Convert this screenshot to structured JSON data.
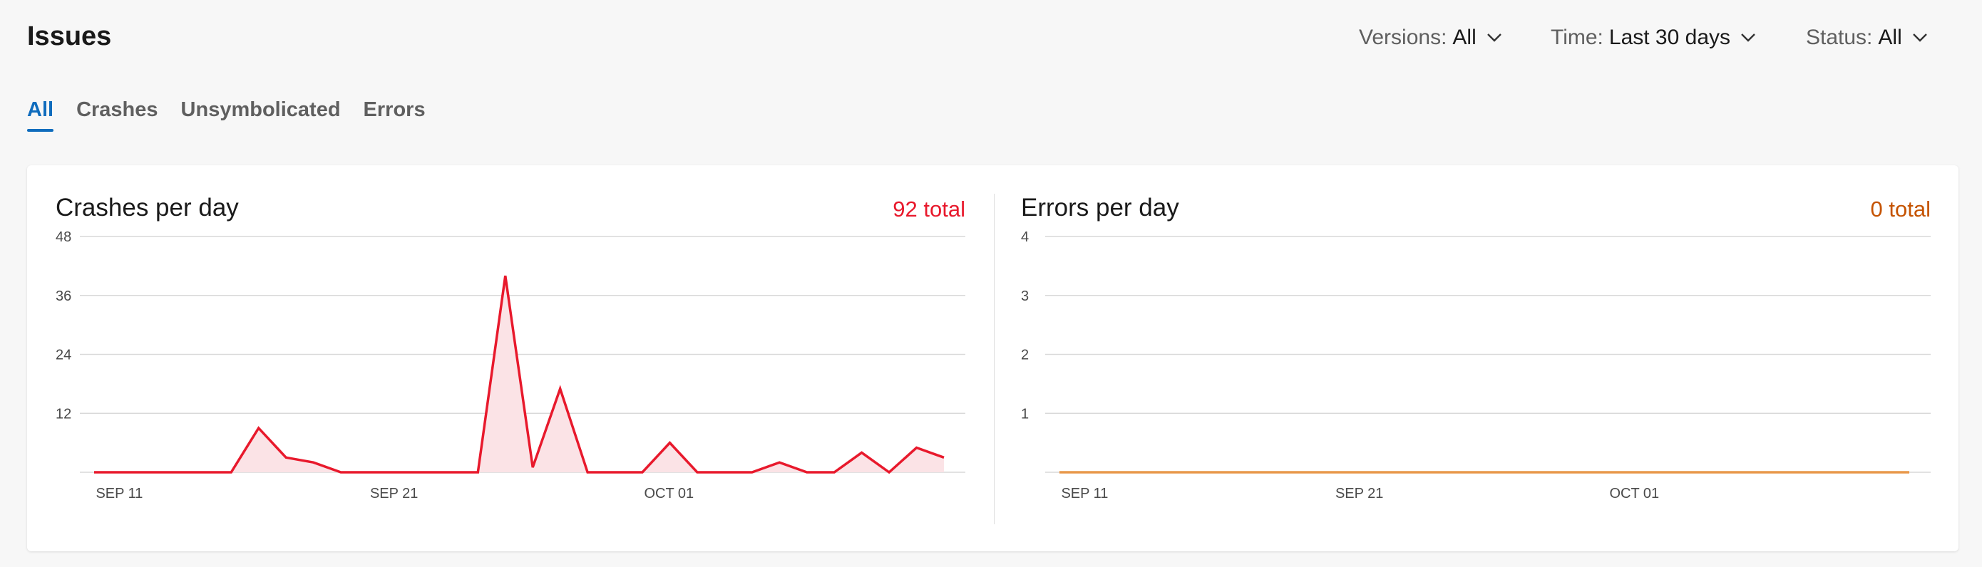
{
  "header": {
    "title": "Issues"
  },
  "filters": {
    "versions": {
      "label": "Versions:",
      "value": "All"
    },
    "time": {
      "label": "Time:",
      "value": "Last 30 days"
    },
    "status": {
      "label": "Status:",
      "value": "All"
    }
  },
  "tabs": [
    {
      "label": "All",
      "active": true
    },
    {
      "label": "Crashes",
      "active": false
    },
    {
      "label": "Unsymbolicated",
      "active": false
    },
    {
      "label": "Errors",
      "active": false
    }
  ],
  "colors": {
    "accent": "#0f6cbd",
    "crash_line": "#e8192c",
    "crash_fill": "#fbe3e6",
    "crash_total": "#e8192c",
    "error_line": "#e8984a",
    "error_total": "#c55300"
  },
  "panels": {
    "crashes": {
      "title": "Crashes per day",
      "total": "92 total"
    },
    "errors": {
      "title": "Errors per day",
      "total": "0 total"
    }
  },
  "chart_data": [
    {
      "type": "area",
      "title": "Crashes per day",
      "x": [
        "SEP 10",
        "SEP 11",
        "SEP 12",
        "SEP 13",
        "SEP 14",
        "SEP 15",
        "SEP 16",
        "SEP 17",
        "SEP 18",
        "SEP 19",
        "SEP 20",
        "SEP 21",
        "SEP 22",
        "SEP 23",
        "SEP 24",
        "SEP 25",
        "SEP 26",
        "SEP 27",
        "SEP 28",
        "SEP 29",
        "SEP 30",
        "OCT 01",
        "OCT 02",
        "OCT 03",
        "OCT 04",
        "OCT 05",
        "OCT 06",
        "OCT 07",
        "OCT 08",
        "OCT 09",
        "OCT 10",
        "OCT 11"
      ],
      "series": [
        {
          "values": [
            0,
            0,
            0,
            0,
            0,
            0,
            9,
            3,
            2,
            0,
            0,
            0,
            0,
            0,
            0,
            40,
            1,
            17,
            0,
            0,
            0,
            6,
            0,
            0,
            0,
            2,
            0,
            0,
            4,
            0,
            5,
            3
          ]
        }
      ],
      "ylim": [
        0,
        48
      ],
      "yticks": [
        "48",
        "36",
        "24",
        "12"
      ],
      "xtick_labels": [
        "SEP 11",
        "SEP 21",
        "OCT 01"
      ],
      "grid": true
    },
    {
      "type": "line",
      "title": "Errors per day",
      "x": [
        "SEP 10",
        "SEP 11",
        "SEP 12",
        "SEP 13",
        "SEP 14",
        "SEP 15",
        "SEP 16",
        "SEP 17",
        "SEP 18",
        "SEP 19",
        "SEP 20",
        "SEP 21",
        "SEP 22",
        "SEP 23",
        "SEP 24",
        "SEP 25",
        "SEP 26",
        "SEP 27",
        "SEP 28",
        "SEP 29",
        "SEP 30",
        "OCT 01",
        "OCT 02",
        "OCT 03",
        "OCT 04",
        "OCT 05",
        "OCT 06",
        "OCT 07",
        "OCT 08",
        "OCT 09",
        "OCT 10",
        "OCT 11"
      ],
      "series": [
        {
          "values": [
            0,
            0,
            0,
            0,
            0,
            0,
            0,
            0,
            0,
            0,
            0,
            0,
            0,
            0,
            0,
            0,
            0,
            0,
            0,
            0,
            0,
            0,
            0,
            0,
            0,
            0,
            0,
            0,
            0,
            0,
            0,
            0
          ]
        }
      ],
      "ylim": [
        0,
        4
      ],
      "yticks": [
        "4",
        "3",
        "2",
        "1"
      ],
      "xtick_labels": [
        "SEP 11",
        "SEP 21",
        "OCT 01"
      ],
      "grid": true
    }
  ]
}
